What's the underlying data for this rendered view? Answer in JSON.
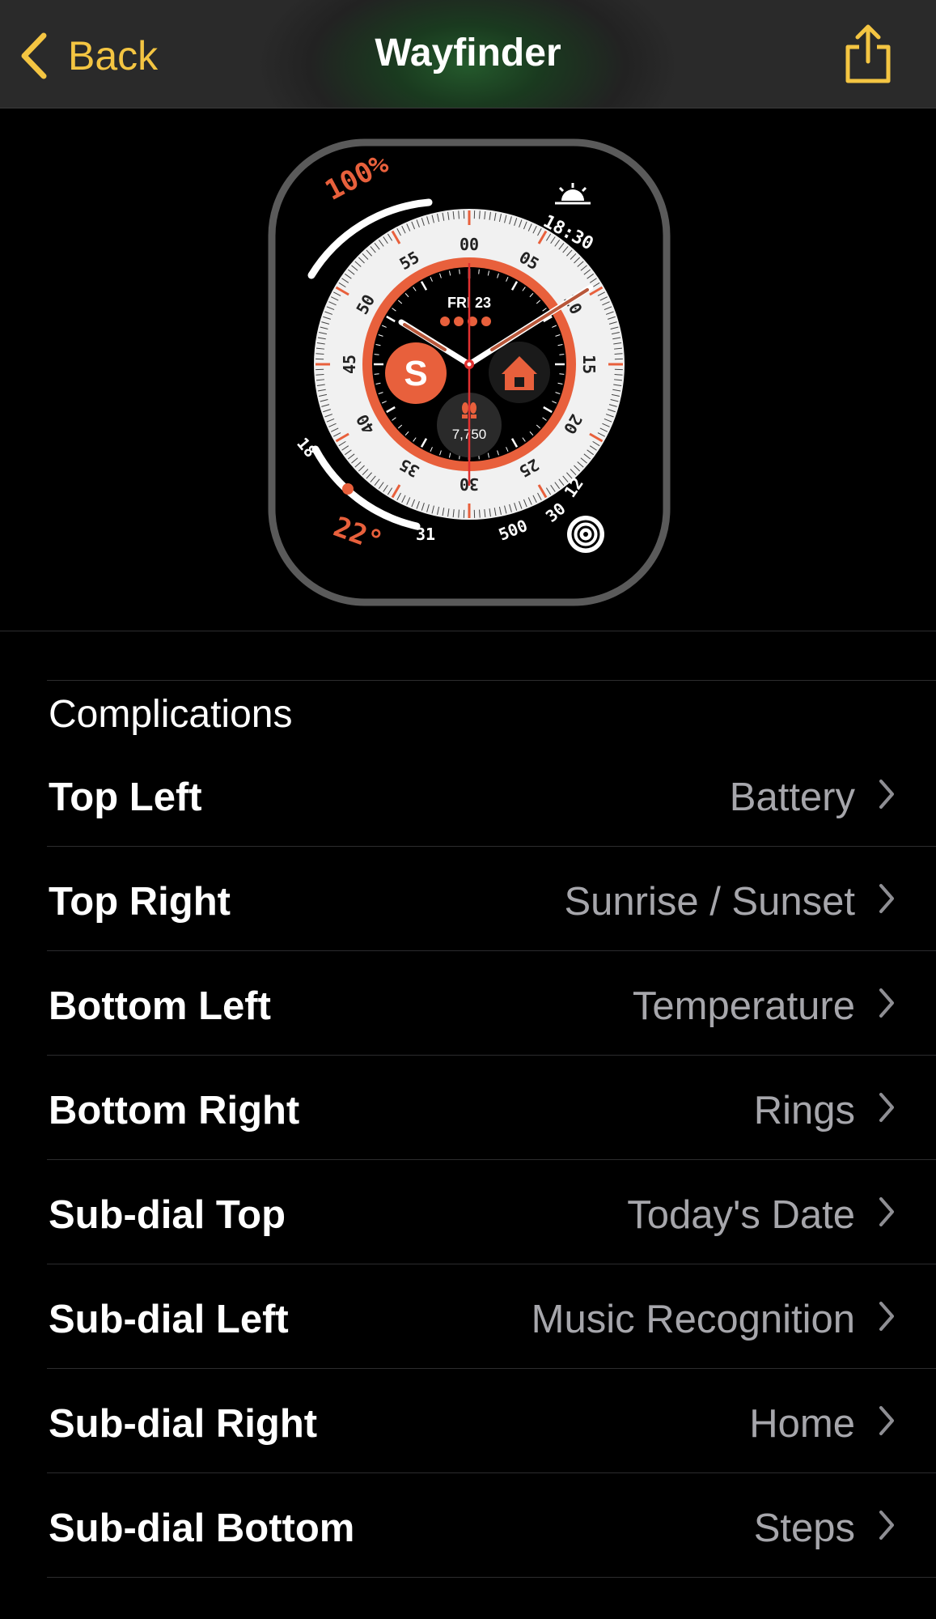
{
  "nav": {
    "back_label": "Back",
    "title": "Wayfinder",
    "accent_color": "#f4c542"
  },
  "watch_face": {
    "battery": "100%",
    "sun_time": "18:30",
    "date": "FRI 23",
    "steps": "7,750",
    "temperature": "22°",
    "temp_low": "18",
    "temp_high": "31",
    "compass_labels": [
      "00",
      "05",
      "10",
      "15",
      "20",
      "25",
      "30",
      "35",
      "40",
      "45",
      "50",
      "55"
    ],
    "distance_labels": [
      "500",
      "30",
      "12"
    ],
    "accent_color": "#e8603c"
  },
  "complications": {
    "header": "Complications",
    "items": [
      {
        "label": "Top Left",
        "value": "Battery"
      },
      {
        "label": "Top Right",
        "value": "Sunrise / Sunset"
      },
      {
        "label": "Bottom Left",
        "value": "Temperature"
      },
      {
        "label": "Bottom Right",
        "value": "Rings"
      },
      {
        "label": "Sub-dial Top",
        "value": "Today's Date"
      },
      {
        "label": "Sub-dial Left",
        "value": "Music Recognition"
      },
      {
        "label": "Sub-dial Right",
        "value": "Home"
      },
      {
        "label": "Sub-dial Bottom",
        "value": "Steps"
      }
    ]
  }
}
